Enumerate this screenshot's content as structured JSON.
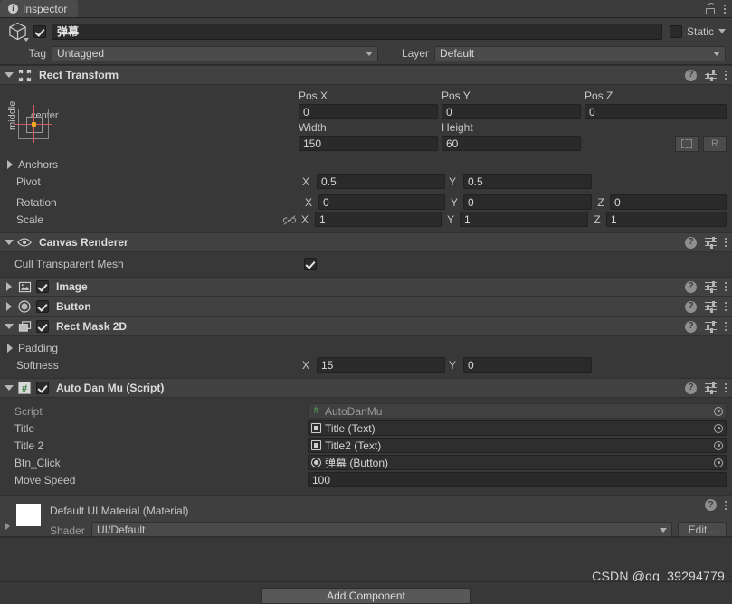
{
  "window": {
    "tab_label": "Inspector",
    "tab_icon": "info-icon",
    "lock_icon": "lock-icon",
    "menu_icon": "kebab-menu-icon"
  },
  "object_header": {
    "icon": "cube-icon",
    "active_checked": true,
    "name": "弹幕",
    "static_label": "Static",
    "tag_label": "Tag",
    "tag_value": "Untagged",
    "layer_label": "Layer",
    "layer_value": "Default"
  },
  "components": [
    {
      "id": "rect-transform",
      "title": "Rect Transform",
      "icon": "rect-transform-icon",
      "expanded": true,
      "has_enable_checkbox": false
    },
    {
      "id": "canvas-renderer",
      "title": "Canvas Renderer",
      "icon": "eye-icon",
      "expanded": true,
      "has_enable_checkbox": false
    },
    {
      "id": "image",
      "title": "Image",
      "icon": "image-icon",
      "expanded": false,
      "has_enable_checkbox": true,
      "enabled": true
    },
    {
      "id": "button",
      "title": "Button",
      "icon": "button-icon",
      "expanded": false,
      "has_enable_checkbox": true,
      "enabled": true
    },
    {
      "id": "rect-mask-2d",
      "title": "Rect Mask 2D",
      "icon": "rect-mask-icon",
      "expanded": true,
      "has_enable_checkbox": true,
      "enabled": true
    },
    {
      "id": "auto-dan-mu",
      "title": "Auto Dan Mu (Script)",
      "icon": "csharp-script-icon",
      "expanded": true,
      "has_enable_checkbox": true,
      "enabled": true
    }
  ],
  "rect_transform": {
    "anchor_preset": {
      "horizontal": "center",
      "vertical": "middle"
    },
    "pos_x_label": "Pos X",
    "pos_x": "0",
    "pos_y_label": "Pos Y",
    "pos_y": "0",
    "pos_z_label": "Pos Z",
    "pos_z": "0",
    "width_label": "Width",
    "width": "150",
    "height_label": "Height",
    "height": "60",
    "blueprint_button": "blueprint-mode-icon",
    "raw_button": "R",
    "anchors_label": "Anchors",
    "pivot_label": "Pivot",
    "pivot_x_axis": "X",
    "pivot_x": "0.5",
    "pivot_y_axis": "Y",
    "pivot_y": "0.5",
    "rotation_label": "Rotation",
    "rotation_x_axis": "X",
    "rotation_x": "0",
    "rotation_y_axis": "Y",
    "rotation_y": "0",
    "rotation_z_axis": "Z",
    "rotation_z": "0",
    "scale_label": "Scale",
    "scale_link_icon": "unlinked-icon",
    "scale_x_axis": "X",
    "scale_x": "1",
    "scale_y_axis": "Y",
    "scale_y": "1",
    "scale_z_axis": "Z",
    "scale_z": "1"
  },
  "canvas_renderer": {
    "cull_transparent_mesh_label": "Cull Transparent Mesh",
    "cull_transparent_mesh_checked": true
  },
  "rect_mask_2d": {
    "padding_label": "Padding",
    "softness_label": "Softness",
    "softness_x_axis": "X",
    "softness_x": "15",
    "softness_y_axis": "Y",
    "softness_y": "0"
  },
  "auto_dan_mu": {
    "fields": [
      {
        "label": "Script",
        "value": "AutoDanMu",
        "badge": "csharp-script-icon",
        "disabled": true,
        "type": "object"
      },
      {
        "label": "Title",
        "value": "Title (Text)",
        "badge": "text-component-icon",
        "disabled": false,
        "type": "object"
      },
      {
        "label": "Title 2",
        "value": "Title2 (Text)",
        "badge": "text-component-icon",
        "disabled": false,
        "type": "object"
      },
      {
        "label": "Btn_Click",
        "value": "弹幕 (Button)",
        "badge": "button-component-icon",
        "disabled": false,
        "type": "object"
      },
      {
        "label": "Move Speed",
        "value": "100",
        "badge": "",
        "disabled": false,
        "type": "number"
      }
    ]
  },
  "material": {
    "title": "Default UI Material (Material)",
    "swatch_color": "#ffffff",
    "shader_label": "Shader",
    "shader_value": "UI/Default",
    "edit_label": "Edit..."
  },
  "add_component": {
    "label": "Add Component"
  },
  "watermark": {
    "text": "CSDN @qq_39294779"
  },
  "icons": {
    "help": "?",
    "preset": "preset-icon",
    "menu": "kebab-menu-icon"
  },
  "colors": {
    "background": "#383838",
    "header": "#414141",
    "field": "#2a2a2a",
    "accent_orange": "#f0a81e",
    "anchor_red": "#d05a5a",
    "script_green": "#4e9c4e"
  }
}
